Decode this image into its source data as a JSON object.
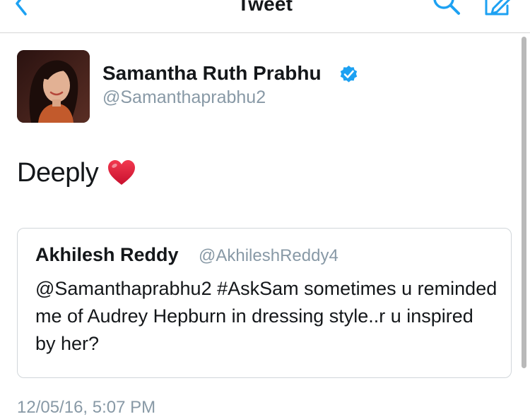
{
  "nav": {
    "title": "Tweet",
    "icons": {
      "back": "chevron-left-icon",
      "search": "search-icon",
      "compose": "compose-icon"
    },
    "accent_color": "#1da1f2"
  },
  "tweet": {
    "author_name": "Samantha Ruth Prabhu",
    "author_handle": "@Samanthaprabhu2",
    "verified": true,
    "text": "Deeply",
    "emoji": "heart-emoji",
    "timestamp": "12/05/16, 5:07 PM"
  },
  "quoted_tweet": {
    "author_name": "Akhilesh Reddy",
    "author_handle": "@AkhileshReddy4",
    "text": "@Samanthaprabhu2 #AskSam sometimes u reminded me of Audrey Hepburn in dressing style..r u inspired by her?"
  },
  "colors": {
    "primary_text": "#14171a",
    "secondary_text": "#8899a6",
    "verified_badge": "#1da1f2",
    "heart": "#e0143c"
  }
}
